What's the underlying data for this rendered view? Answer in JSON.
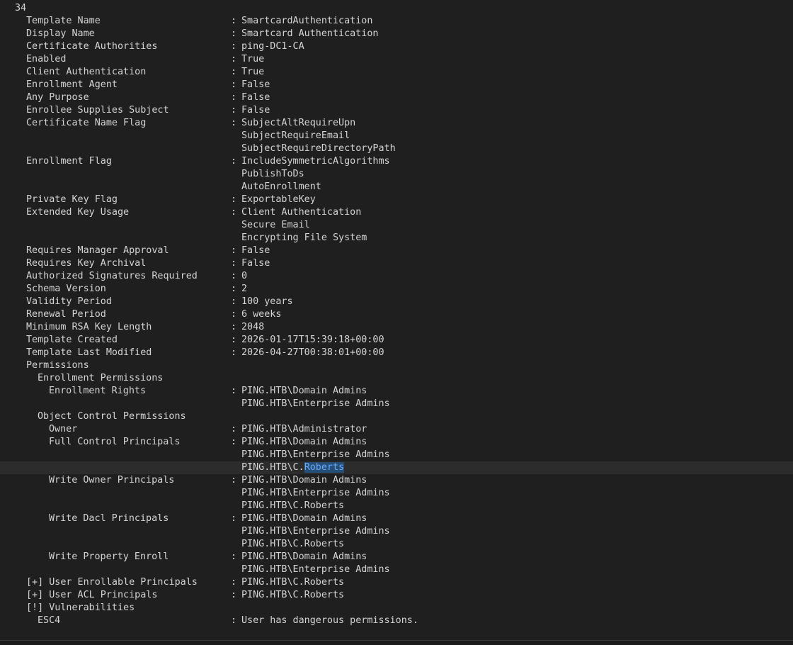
{
  "terminal": {
    "header_number": "34",
    "rows": [
      {
        "indent": 1,
        "label": "Template Name",
        "sep": ":",
        "value": "SmartcardAuthentication"
      },
      {
        "indent": 1,
        "label": "Display Name",
        "sep": ":",
        "value": "Smartcard Authentication"
      },
      {
        "indent": 1,
        "label": "Certificate Authorities",
        "sep": ":",
        "value": "ping-DC1-CA"
      },
      {
        "indent": 1,
        "label": "Enabled",
        "sep": ":",
        "value": "True"
      },
      {
        "indent": 1,
        "label": "Client Authentication",
        "sep": ":",
        "value": "True"
      },
      {
        "indent": 1,
        "label": "Enrollment Agent",
        "sep": ":",
        "value": "False"
      },
      {
        "indent": 1,
        "label": "Any Purpose",
        "sep": ":",
        "value": "False"
      },
      {
        "indent": 1,
        "label": "Enrollee Supplies Subject",
        "sep": ":",
        "value": "False"
      },
      {
        "indent": 1,
        "label": "Certificate Name Flag",
        "sep": ":",
        "value": "SubjectAltRequireUpn"
      },
      {
        "indent": 1,
        "label": "",
        "sep": "",
        "value": "SubjectRequireEmail"
      },
      {
        "indent": 1,
        "label": "",
        "sep": "",
        "value": "SubjectRequireDirectoryPath"
      },
      {
        "indent": 1,
        "label": "Enrollment Flag",
        "sep": ":",
        "value": "IncludeSymmetricAlgorithms"
      },
      {
        "indent": 1,
        "label": "",
        "sep": "",
        "value": "PublishToDs"
      },
      {
        "indent": 1,
        "label": "",
        "sep": "",
        "value": "AutoEnrollment"
      },
      {
        "indent": 1,
        "label": "Private Key Flag",
        "sep": ":",
        "value": "ExportableKey"
      },
      {
        "indent": 1,
        "label": "Extended Key Usage",
        "sep": ":",
        "value": "Client Authentication"
      },
      {
        "indent": 1,
        "label": "",
        "sep": "",
        "value": "Secure Email"
      },
      {
        "indent": 1,
        "label": "",
        "sep": "",
        "value": "Encrypting File System"
      },
      {
        "indent": 1,
        "label": "Requires Manager Approval",
        "sep": ":",
        "value": "False"
      },
      {
        "indent": 1,
        "label": "Requires Key Archival",
        "sep": ":",
        "value": "False"
      },
      {
        "indent": 1,
        "label": "Authorized Signatures Required",
        "sep": ":",
        "value": "0"
      },
      {
        "indent": 1,
        "label": "Schema Version",
        "sep": ":",
        "value": "2"
      },
      {
        "indent": 1,
        "label": "Validity Period",
        "sep": ":",
        "value": "100 years"
      },
      {
        "indent": 1,
        "label": "Renewal Period",
        "sep": ":",
        "value": "6 weeks"
      },
      {
        "indent": 1,
        "label": "Minimum RSA Key Length",
        "sep": ":",
        "value": "2048"
      },
      {
        "indent": 1,
        "label": "Template Created",
        "sep": ":",
        "value": "2026-01-17T15:39:18+00:00"
      },
      {
        "indent": 1,
        "label": "Template Last Modified",
        "sep": ":",
        "value": "2026-04-27T00:38:01+00:00"
      },
      {
        "indent": 1,
        "label": "Permissions",
        "sep": "",
        "value": ""
      },
      {
        "indent": 2,
        "label": "Enrollment Permissions",
        "sep": "",
        "value": ""
      },
      {
        "indent": 3,
        "label": "Enrollment Rights",
        "sep": ":",
        "value": "PING.HTB\\Domain Admins"
      },
      {
        "indent": 3,
        "label": "",
        "sep": "",
        "value": "PING.HTB\\Enterprise Admins"
      },
      {
        "indent": 2,
        "label": "Object Control Permissions",
        "sep": "",
        "value": ""
      },
      {
        "indent": 3,
        "label": "Owner",
        "sep": ":",
        "value": "PING.HTB\\Administrator"
      },
      {
        "indent": 3,
        "label": "Full Control Principals",
        "sep": ":",
        "value": "PING.HTB\\Domain Admins"
      },
      {
        "indent": 3,
        "label": "",
        "sep": "",
        "value": "PING.HTB\\Enterprise Admins"
      },
      {
        "indent": 3,
        "label": "",
        "sep": "",
        "value": "PING.HTB\\C.",
        "highlight": "Roberts",
        "current": true
      },
      {
        "indent": 3,
        "label": "Write Owner Principals",
        "sep": ":",
        "value": "PING.HTB\\Domain Admins"
      },
      {
        "indent": 3,
        "label": "",
        "sep": "",
        "value": "PING.HTB\\Enterprise Admins"
      },
      {
        "indent": 3,
        "label": "",
        "sep": "",
        "value": "PING.HTB\\C.Roberts"
      },
      {
        "indent": 3,
        "label": "Write Dacl Principals",
        "sep": ":",
        "value": "PING.HTB\\Domain Admins"
      },
      {
        "indent": 3,
        "label": "",
        "sep": "",
        "value": "PING.HTB\\Enterprise Admins"
      },
      {
        "indent": 3,
        "label": "",
        "sep": "",
        "value": "PING.HTB\\C.Roberts"
      },
      {
        "indent": 3,
        "label": "Write Property Enroll",
        "sep": ":",
        "value": "PING.HTB\\Domain Admins"
      },
      {
        "indent": 3,
        "label": "",
        "sep": "",
        "value": "PING.HTB\\Enterprise Admins"
      },
      {
        "indent": 1,
        "label": "[+] User Enrollable Principals",
        "sep": ":",
        "value": "PING.HTB\\C.Roberts"
      },
      {
        "indent": 1,
        "label": "[+] User ACL Principals",
        "sep": ":",
        "value": "PING.HTB\\C.Roberts"
      },
      {
        "indent": 1,
        "label": "[!] Vulnerabilities",
        "sep": "",
        "value": ""
      },
      {
        "indent": 2,
        "label": "ESC4",
        "sep": ":",
        "value": "User has dangerous permissions."
      }
    ]
  },
  "colors": {
    "background": "#1f1f1f",
    "text": "#d4d4d4",
    "current_line": "#2c2c2c",
    "selection_bg": "#264f78",
    "selection_text": "#6aa9ff"
  }
}
